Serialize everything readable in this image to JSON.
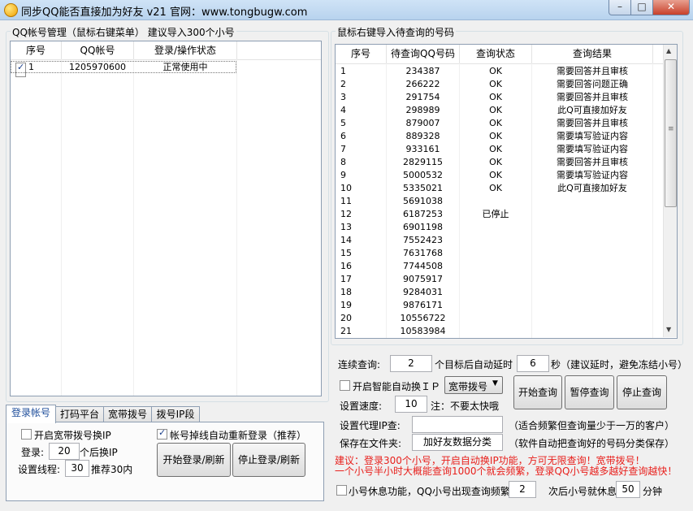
{
  "window": {
    "title": "同步QQ能否直接加为好友 v21  官网：www.tongbugw.com",
    "min": "–",
    "max": "□",
    "close": "✕"
  },
  "left": {
    "group_title": "QQ帐号管理（鼠标右键菜单）   建议导入300个小号",
    "headers": [
      "序号",
      "QQ帐号",
      "登录/操作状态"
    ],
    "rows": [
      {
        "no": "1",
        "qq": "1205970600",
        "status": "正常使用中",
        "checked": true
      }
    ]
  },
  "right": {
    "group_title": "鼠标右键导入待查询的号码",
    "headers": [
      "序号",
      "待查询QQ号码",
      "查询状态",
      "查询结果"
    ],
    "rows": [
      {
        "no": "1",
        "qq": "234387",
        "state": "OK",
        "result": "需要回答并且审核"
      },
      {
        "no": "2",
        "qq": "266222",
        "state": "OK",
        "result": "需要回答问题正确"
      },
      {
        "no": "3",
        "qq": "291754",
        "state": "OK",
        "result": "需要回答并且审核"
      },
      {
        "no": "4",
        "qq": "298989",
        "state": "OK",
        "result": "此Q可直接加好友"
      },
      {
        "no": "5",
        "qq": "879007",
        "state": "OK",
        "result": "需要回答并且审核"
      },
      {
        "no": "6",
        "qq": "889328",
        "state": "OK",
        "result": "需要填写验证内容"
      },
      {
        "no": "7",
        "qq": "933161",
        "state": "OK",
        "result": "需要填写验证内容"
      },
      {
        "no": "8",
        "qq": "2829115",
        "state": "OK",
        "result": "需要回答并且审核"
      },
      {
        "no": "9",
        "qq": "5000532",
        "state": "OK",
        "result": "需要填写验证内容"
      },
      {
        "no": "10",
        "qq": "5335021",
        "state": "OK",
        "result": "此Q可直接加好友"
      },
      {
        "no": "11",
        "qq": "5691038",
        "state": "",
        "result": ""
      },
      {
        "no": "12",
        "qq": "6187253",
        "state": "已停止",
        "result": ""
      },
      {
        "no": "13",
        "qq": "6901198",
        "state": "",
        "result": ""
      },
      {
        "no": "14",
        "qq": "7552423",
        "state": "",
        "result": ""
      },
      {
        "no": "15",
        "qq": "7631768",
        "state": "",
        "result": ""
      },
      {
        "no": "16",
        "qq": "7744508",
        "state": "",
        "result": ""
      },
      {
        "no": "17",
        "qq": "9075917",
        "state": "",
        "result": ""
      },
      {
        "no": "18",
        "qq": "9284031",
        "state": "",
        "result": ""
      },
      {
        "no": "19",
        "qq": "9876171",
        "state": "",
        "result": ""
      },
      {
        "no": "20",
        "qq": "10556722",
        "state": "",
        "result": ""
      },
      {
        "no": "21",
        "qq": "10583984",
        "state": "",
        "result": ""
      }
    ]
  },
  "tabs": [
    "登录帐号",
    "打码平台",
    "宽带拨号",
    "拨号IP段"
  ],
  "login": {
    "broadband_label": "开启宽带拨号换IP",
    "login_label": "登录:",
    "login_value": "20",
    "login_suffix": "个后换IP",
    "threads_label": "设置线程:",
    "threads_value": "30",
    "threads_suffix": "推荐30内",
    "relogin_label": "帐号掉线自动重新登录（推荐）",
    "start_btn": "开始登录/刷新",
    "stop_btn": "停止登录/刷新"
  },
  "query": {
    "continuous_label": "连续查询:",
    "continuous_value": "2",
    "continuous_suffix": "个目标后自动延时",
    "delay_value": "6",
    "delay_suffix": "秒（建议延时，避免冻结小号）",
    "smart_ip_label": "开启智能自动换ＩＰ",
    "dial_option": "宽带拨号",
    "speed_label": "设置速度:",
    "speed_value": "10",
    "speed_note": "注：不要太快哦",
    "proxy_label": "设置代理IP查:",
    "proxy_value": "",
    "proxy_note": "（适合频繁但查询量少于一万的客户）",
    "save_label": "保存在文件夹:",
    "save_value": "加好友数据分类",
    "save_note": "（软件自动把查询好的号码分类保存）",
    "start_btn": "开始查询",
    "pause_btn": "暂停查询",
    "stop_btn": "停止查询",
    "advice_1": "建议：登录300个小号，开启自动换IP功能，方可无限查询！宽带拨号！",
    "advice_2": "一个小号半小时大概能查询1000个就会频繁，登录QQ小号越多越好查询越快！",
    "rest_label": "小号休息功能，QQ小号出现查询频繁",
    "rest_value": "2",
    "rest_mid": "次后小号就休息",
    "rest_minutes": "50",
    "rest_unit": "分钟"
  },
  "colors": {
    "advice": "#e8201c",
    "tab_active": "#1f4e9b"
  }
}
